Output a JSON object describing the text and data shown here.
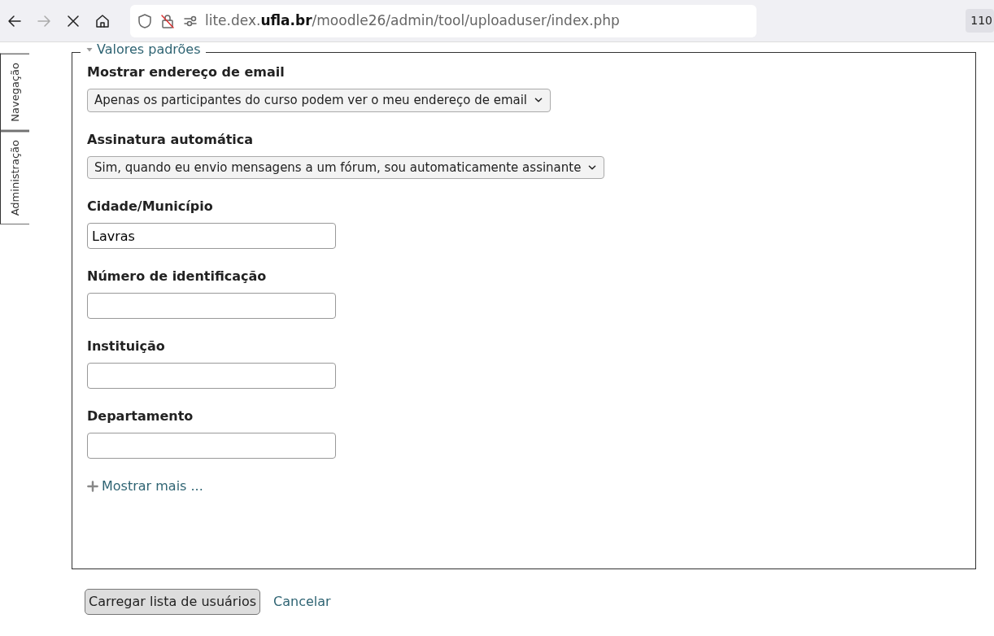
{
  "browser": {
    "url": "lite.dex.**ufla.br**/moodle26/admin/tool/uploaduser/index.php",
    "zoom": "110"
  },
  "side_tabs": [
    {
      "label": "Navegação"
    },
    {
      "label": "Administração"
    }
  ],
  "fieldset": {
    "legend": "Valores padrões",
    "expanded": true,
    "fields": [
      {
        "kind": "select",
        "label": "Mostrar endereço de email",
        "value": "Apenas os participantes do curso podem ver o meu endereço de email"
      },
      {
        "kind": "select",
        "label": "Assinatura automática",
        "value": "Sim, quando eu envio mensagens a um fórum, sou automaticamente assinante"
      },
      {
        "kind": "text",
        "label": "Cidade/Município",
        "value": "Lavras"
      },
      {
        "kind": "text",
        "label": "Número de identificação"
      },
      {
        "kind": "text",
        "label": "Instituição"
      },
      {
        "kind": "text",
        "label": "Departamento"
      }
    ],
    "more_link": "Mostrar mais ..."
  },
  "actions": {
    "submit": "Carregar lista de usuários",
    "cancel": "Cancelar"
  }
}
